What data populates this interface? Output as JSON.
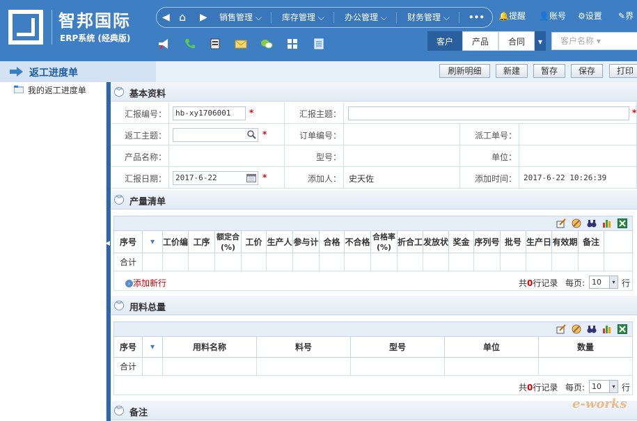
{
  "app": {
    "name": "智邦国际",
    "subtitle": "ERP系统 (经典版)"
  },
  "nav": {
    "menus": [
      "销售管理",
      "库存管理",
      "办公管理",
      "财务管理"
    ],
    "more": "•••",
    "top_links": [
      "提醒",
      "账号",
      "设置",
      "界"
    ]
  },
  "tabs": [
    "客户",
    "产品",
    "合同"
  ],
  "search": {
    "placeholder": "客户名称"
  },
  "page": {
    "title": "返工进度单",
    "left_item": "我的返工进度单"
  },
  "toolbar": [
    "刷新明细",
    "新建",
    "暂存",
    "保存",
    "打印"
  ],
  "basic": {
    "title": "基本资料",
    "report_no_label": "汇报编号：",
    "report_no": "hb-xy1706001",
    "report_subject_label": "汇报主题：",
    "rework_subject_label": "返工主题：",
    "order_no_label": "订单编号：",
    "dispatch_no_label": "派工单号：",
    "product_name_label": "产品名称：",
    "model_label": "型号：",
    "unit_label": "单位：",
    "report_date_label": "汇报日期：",
    "report_date": "2017-6-22",
    "adder_label": "添加人：",
    "adder": "史天佐",
    "add_time_label": "添加时间：",
    "add_time": "2017-6-22 10:26:39"
  },
  "output_list": {
    "title": "产量清单",
    "headers": [
      "序号",
      "",
      "工价编",
      "工序",
      "额定合 (%)",
      "工价",
      "生产人",
      "参与计",
      "合格数",
      "不合格",
      "合格率 (%)",
      "折合工",
      "发放状",
      "奖金",
      "序列号",
      "批号",
      "生产日",
      "有效期",
      "备注"
    ],
    "total_label": "合计",
    "add_row": "添加新行",
    "record_prefix": "共",
    "record_count": "0",
    "record_suffix": "行记录",
    "per_page_label": "每页:",
    "per_page": "10",
    "per_page_suffix": "行"
  },
  "material": {
    "title": "用料总量",
    "headers": [
      "序号",
      "",
      "用料名称",
      "料号",
      "型号",
      "单位",
      "数量"
    ],
    "total_label": "合计",
    "record_prefix": "共",
    "record_count": "0",
    "record_suffix": "行记录",
    "per_page_label": "每页:",
    "per_page": "10",
    "per_page_suffix": "行"
  },
  "remark": {
    "title": "备注"
  },
  "watermark": "e-works",
  "colors": {
    "top_bar": "#3e7fc4",
    "accent_dark": "#2f66a6",
    "required": "#dd0000"
  }
}
